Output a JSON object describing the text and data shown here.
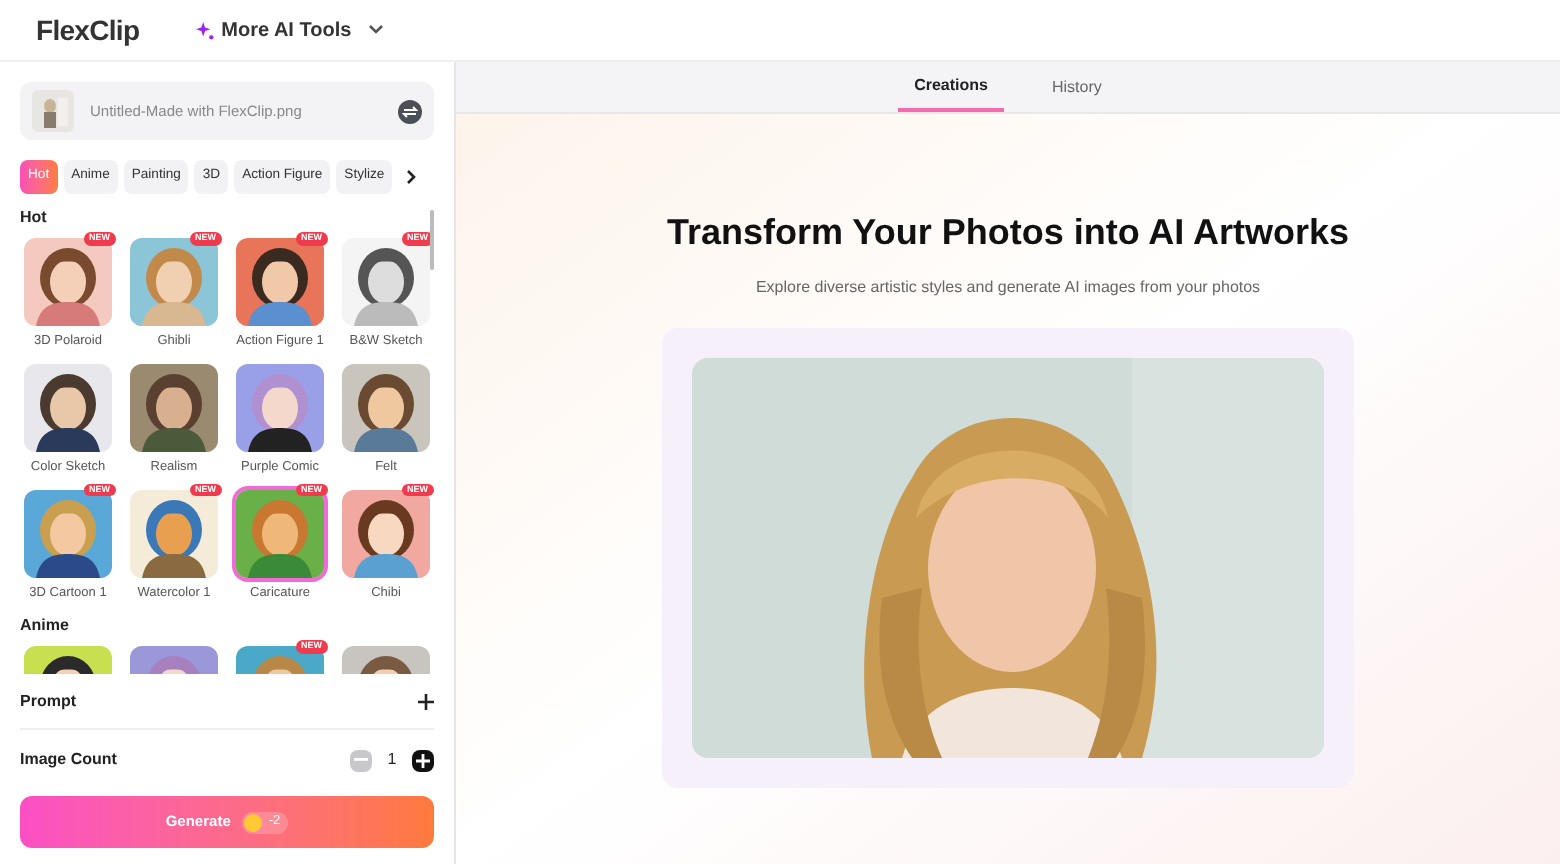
{
  "header": {
    "logo": "FlexClip",
    "menu": "More AI Tools"
  },
  "upload": {
    "filename": "Untitled-Made with FlexClip.png"
  },
  "categories": [
    {
      "label": "Hot",
      "selected": true
    },
    {
      "label": "Anime",
      "selected": false
    },
    {
      "label": "Painting",
      "selected": false
    },
    {
      "label": "3D",
      "selected": false
    },
    {
      "label": "Action Figure",
      "selected": false
    },
    {
      "label": "Stylize",
      "selected": false
    }
  ],
  "sections": [
    {
      "title": "Hot",
      "styles": [
        {
          "label": "3D Polaroid",
          "badge": "NEW",
          "selected": false
        },
        {
          "label": "Ghibli",
          "badge": "NEW",
          "selected": false
        },
        {
          "label": "Action Figure 1",
          "badge": "NEW",
          "selected": false
        },
        {
          "label": "B&W Sketch",
          "badge": "NEW",
          "selected": false
        },
        {
          "label": "Color Sketch",
          "selected": false
        },
        {
          "label": "Realism",
          "selected": false
        },
        {
          "label": "Purple Comic",
          "selected": false
        },
        {
          "label": "Felt",
          "selected": false
        },
        {
          "label": "3D Cartoon 1",
          "badge": "NEW",
          "selected": false
        },
        {
          "label": "Watercolor 1",
          "badge": "NEW",
          "selected": false
        },
        {
          "label": "Caricature",
          "badge": "NEW",
          "selected": true
        },
        {
          "label": "Chibi",
          "badge": "NEW",
          "selected": false
        }
      ]
    },
    {
      "title": "Anime",
      "styles": [
        {
          "selected": false
        },
        {
          "selected": false
        },
        {
          "badge": "NEW",
          "selected": false
        },
        {
          "selected": false
        }
      ]
    }
  ],
  "prompt": {
    "label": "Prompt"
  },
  "image_count": {
    "label": "Image Count",
    "value": "1"
  },
  "generate": {
    "label": "Generate",
    "cost": "-2"
  },
  "tabs": [
    {
      "label": "Creations",
      "selected": true
    },
    {
      "label": "History",
      "selected": false
    }
  ],
  "hero": {
    "title": "Transform Your Photos into AI Artworks",
    "subtitle": "Explore diverse artistic styles and generate AI images from your photos"
  }
}
